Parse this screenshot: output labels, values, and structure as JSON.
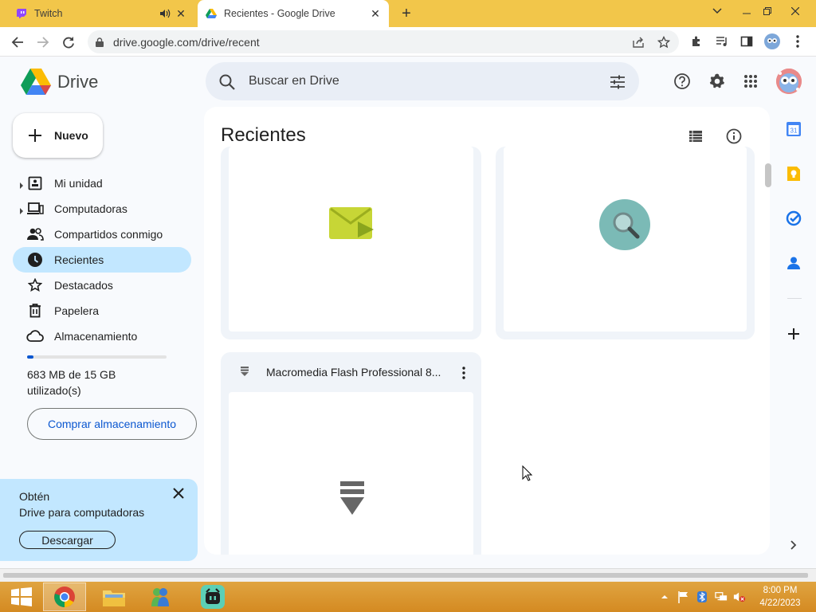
{
  "browser": {
    "tabs": [
      {
        "label": "Twitch",
        "icon": "twitch-icon",
        "audio": true
      },
      {
        "label": "Recientes - Google Drive",
        "icon": "drive-icon",
        "active": true
      }
    ],
    "url": "drive.google.com/drive/recent"
  },
  "drive": {
    "brand": "Drive",
    "search_placeholder": "Buscar en Drive",
    "new_label": "Nuevo",
    "nav": [
      {
        "label": "Mi unidad",
        "icon": "my-drive-icon",
        "expandable": true
      },
      {
        "label": "Computadoras",
        "icon": "computers-icon",
        "expandable": true
      },
      {
        "label": "Compartidos conmigo",
        "icon": "shared-icon"
      },
      {
        "label": "Recientes",
        "icon": "clock-icon",
        "active": true
      },
      {
        "label": "Destacados",
        "icon": "star-icon"
      },
      {
        "label": "Papelera",
        "icon": "trash-icon"
      },
      {
        "label": "Almacenamiento",
        "icon": "cloud-icon"
      }
    ],
    "storage": {
      "used_text": "683 MB de 15 GB utilizado(s)",
      "fraction": 0.045
    },
    "buy_storage_label": "Comprar almacenamiento",
    "promo": {
      "line1": "Obtén",
      "line2": "Drive para computadoras",
      "button": "Descargar"
    },
    "main": {
      "title": "Recientes",
      "files": [
        {
          "name": "",
          "thumb_icon": "mail-video-icon"
        },
        {
          "name": "",
          "thumb_icon": "search-magnifier-icon"
        },
        {
          "name": "Macromedia Flash Professional 8...",
          "thumb_icon": "installer-icon"
        }
      ]
    }
  },
  "taskbar": {
    "time": "8:00 PM",
    "date": "4/22/2023"
  },
  "colors": {
    "accent": "#0b57d0",
    "active_nav": "#c2e7ff",
    "tabstrip": "#f2c64a",
    "taskbar": "#d48a22"
  }
}
